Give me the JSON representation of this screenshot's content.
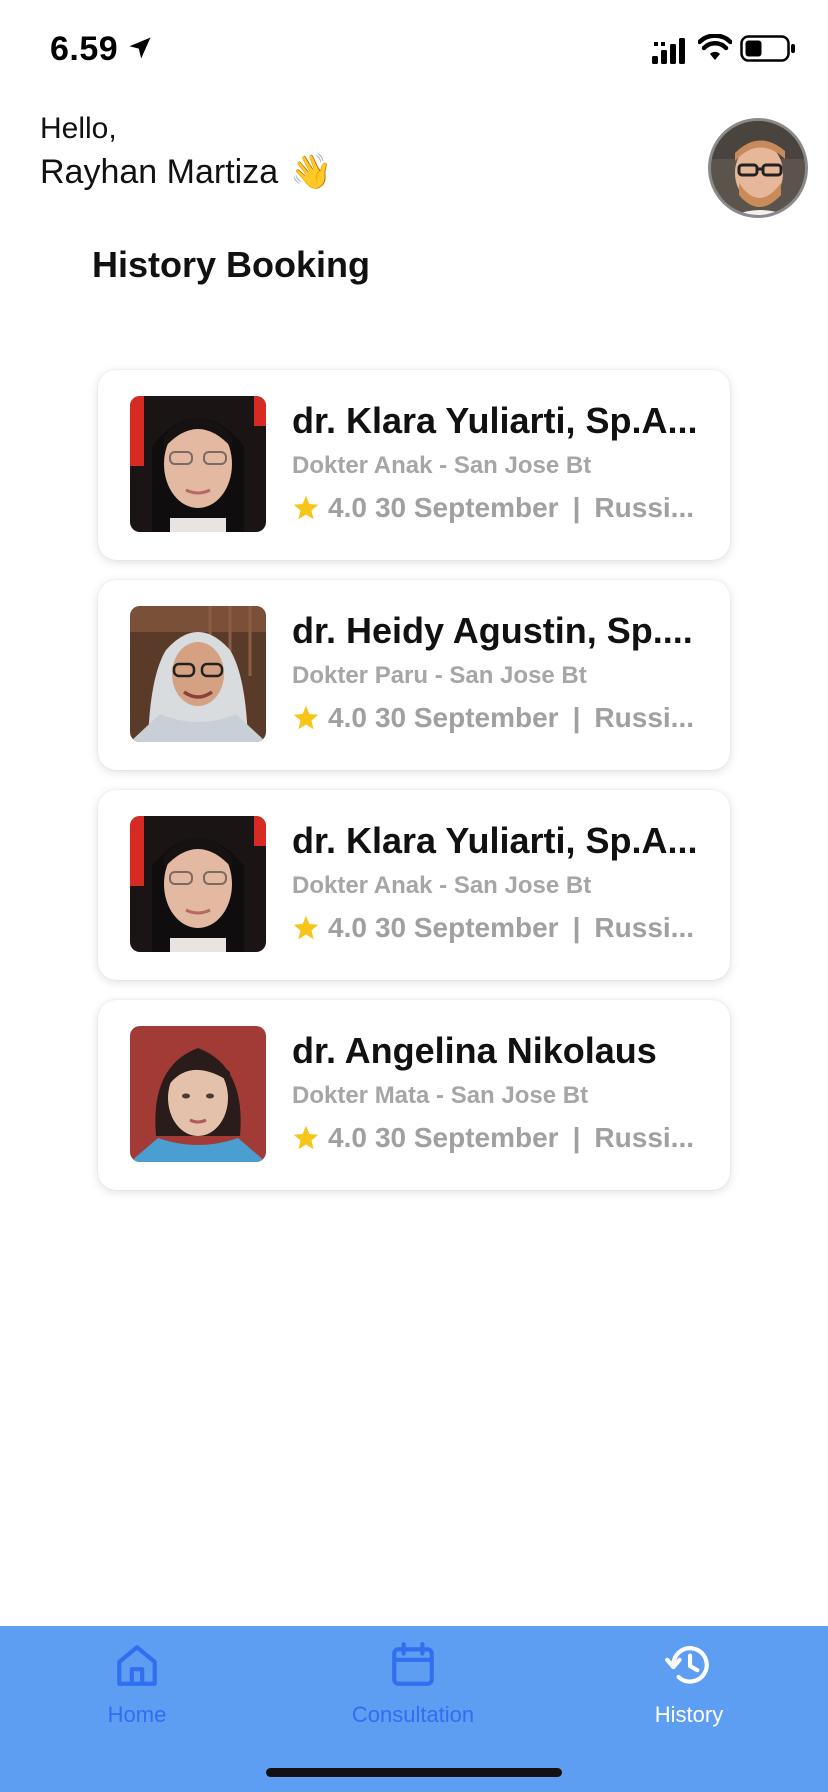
{
  "status_bar": {
    "time": "6.59"
  },
  "header": {
    "greeting": "Hello,",
    "user_name": "Rayhan Martiza",
    "wave_emoji": "👋"
  },
  "section_title": "History Booking",
  "bookings": [
    {
      "name": "dr. Klara Yuliarti, Sp.A...",
      "specialty": "Dokter Anak - San Jose Bt",
      "rating": "4.0",
      "date": "30 September",
      "location": "Russi..."
    },
    {
      "name": "dr. Heidy Agustin, Sp....",
      "specialty": "Dokter Paru - San Jose Bt",
      "rating": "4.0",
      "date": "30 September",
      "location": "Russi..."
    },
    {
      "name": "dr. Klara Yuliarti, Sp.A...",
      "specialty": "Dokter Anak - San Jose Bt",
      "rating": "4.0",
      "date": "30 September",
      "location": "Russi..."
    },
    {
      "name": "dr. Angelina Nikolaus",
      "specialty": "Dokter Mata - San Jose Bt",
      "rating": "4.0",
      "date": "30 September",
      "location": "Russi..."
    }
  ],
  "meta_separator": "|",
  "nav": {
    "home": "Home",
    "consultation": "Consultation",
    "history": "History"
  },
  "colors": {
    "nav_background": "#5d9df2",
    "nav_inactive": "#2f6ff0",
    "nav_active": "#ffffff",
    "star": "#f5c518",
    "muted_text": "#a6a6a6"
  },
  "icons": {
    "status": [
      "location-arrow-icon",
      "signal-icon",
      "wifi-icon",
      "battery-icon"
    ],
    "rating": "star-icon",
    "nav": [
      "home-icon",
      "calendar-icon",
      "history-icon"
    ]
  }
}
